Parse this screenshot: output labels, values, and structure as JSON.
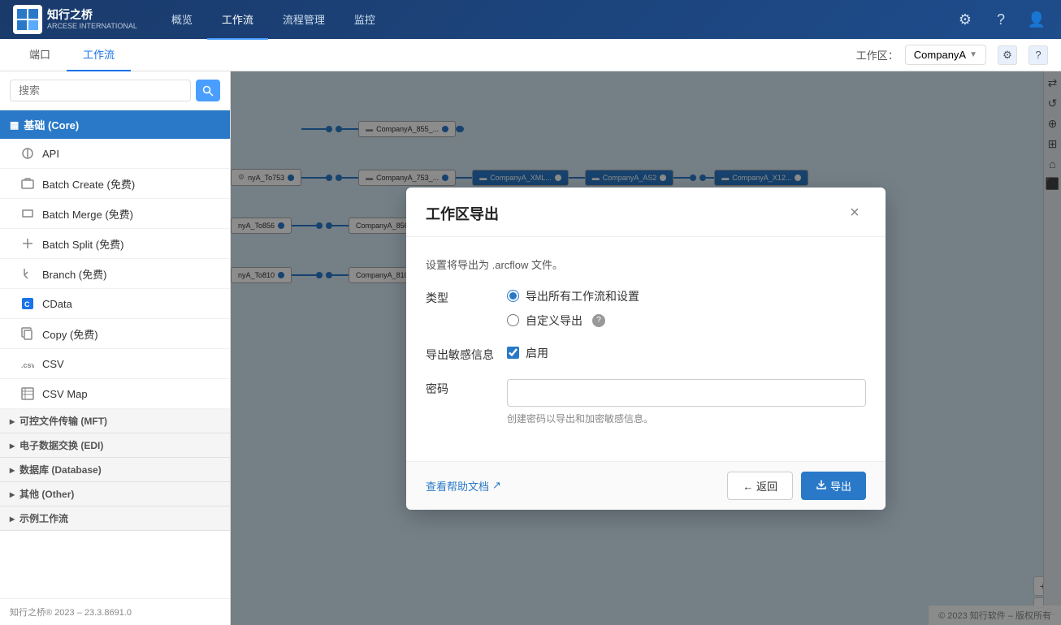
{
  "app": {
    "logo_text_line1": "知行之桥",
    "logo_text_line2": "ARCESE INTERNATIONAL"
  },
  "top_nav": {
    "links": [
      {
        "label": "概览",
        "active": false
      },
      {
        "label": "工作流",
        "active": true
      },
      {
        "label": "流程管理",
        "active": false
      },
      {
        "label": "监控",
        "active": false
      }
    ],
    "icons": [
      "⚙",
      "?",
      "👤"
    ]
  },
  "second_nav": {
    "tabs": [
      {
        "label": "端口",
        "active": false
      },
      {
        "label": "工作流",
        "active": true
      }
    ],
    "workspace_label": "工作区：",
    "workspace_value": "CompanyA"
  },
  "sidebar": {
    "search_placeholder": "搜索",
    "groups": [
      {
        "type": "header",
        "label": "基础 (Core)",
        "icon": "▦"
      },
      {
        "type": "item",
        "label": "API",
        "icon": "⚙"
      },
      {
        "type": "item",
        "label": "Batch Create (免费)",
        "icon": "⚙"
      },
      {
        "type": "item",
        "label": "Batch Merge (免费)",
        "icon": "⚙"
      },
      {
        "type": "item",
        "label": "Batch Split (免费)",
        "icon": "⚙"
      },
      {
        "type": "item",
        "label": "Branch (免费)",
        "icon": "⚙"
      },
      {
        "type": "item",
        "label": "CData",
        "icon": "◼"
      },
      {
        "type": "item",
        "label": "Copy (免费)",
        "icon": "⚙"
      },
      {
        "type": "item",
        "label": "CSV",
        "icon": "⚙"
      },
      {
        "type": "item",
        "label": "CSV Map",
        "icon": "⚙"
      },
      {
        "type": "cat",
        "label": "可控文件传输 (MFT)"
      },
      {
        "type": "cat",
        "label": "电子数据交换 (EDI)"
      },
      {
        "type": "cat",
        "label": "数据库 (Database)"
      },
      {
        "type": "cat",
        "label": "其他 (Other)"
      },
      {
        "type": "cat",
        "label": "示例工作流"
      }
    ],
    "footer": "知行之桥® 2023 – 23.3.8691.0"
  },
  "modal": {
    "title": "工作区导出",
    "close_label": "×",
    "description": "设置将导出为 .arcflow 文件。",
    "type_label": "类型",
    "option_all_label": "导出所有工作流和设置",
    "option_custom_label": "自定义导出",
    "sensitive_label": "导出敏感信息",
    "sensitive_checkbox_label": "启用",
    "password_label": "密码",
    "password_placeholder": "",
    "password_hint": "创建密码以导出和加密敏感信息。",
    "help_link_label": "查看帮助文档",
    "help_link_icon": "↗",
    "btn_back": "← 返回",
    "btn_export_icon": "📋",
    "btn_export_label": "导出"
  },
  "footer": {
    "copyright": "© 2023 知行软件 – 版权所有"
  }
}
